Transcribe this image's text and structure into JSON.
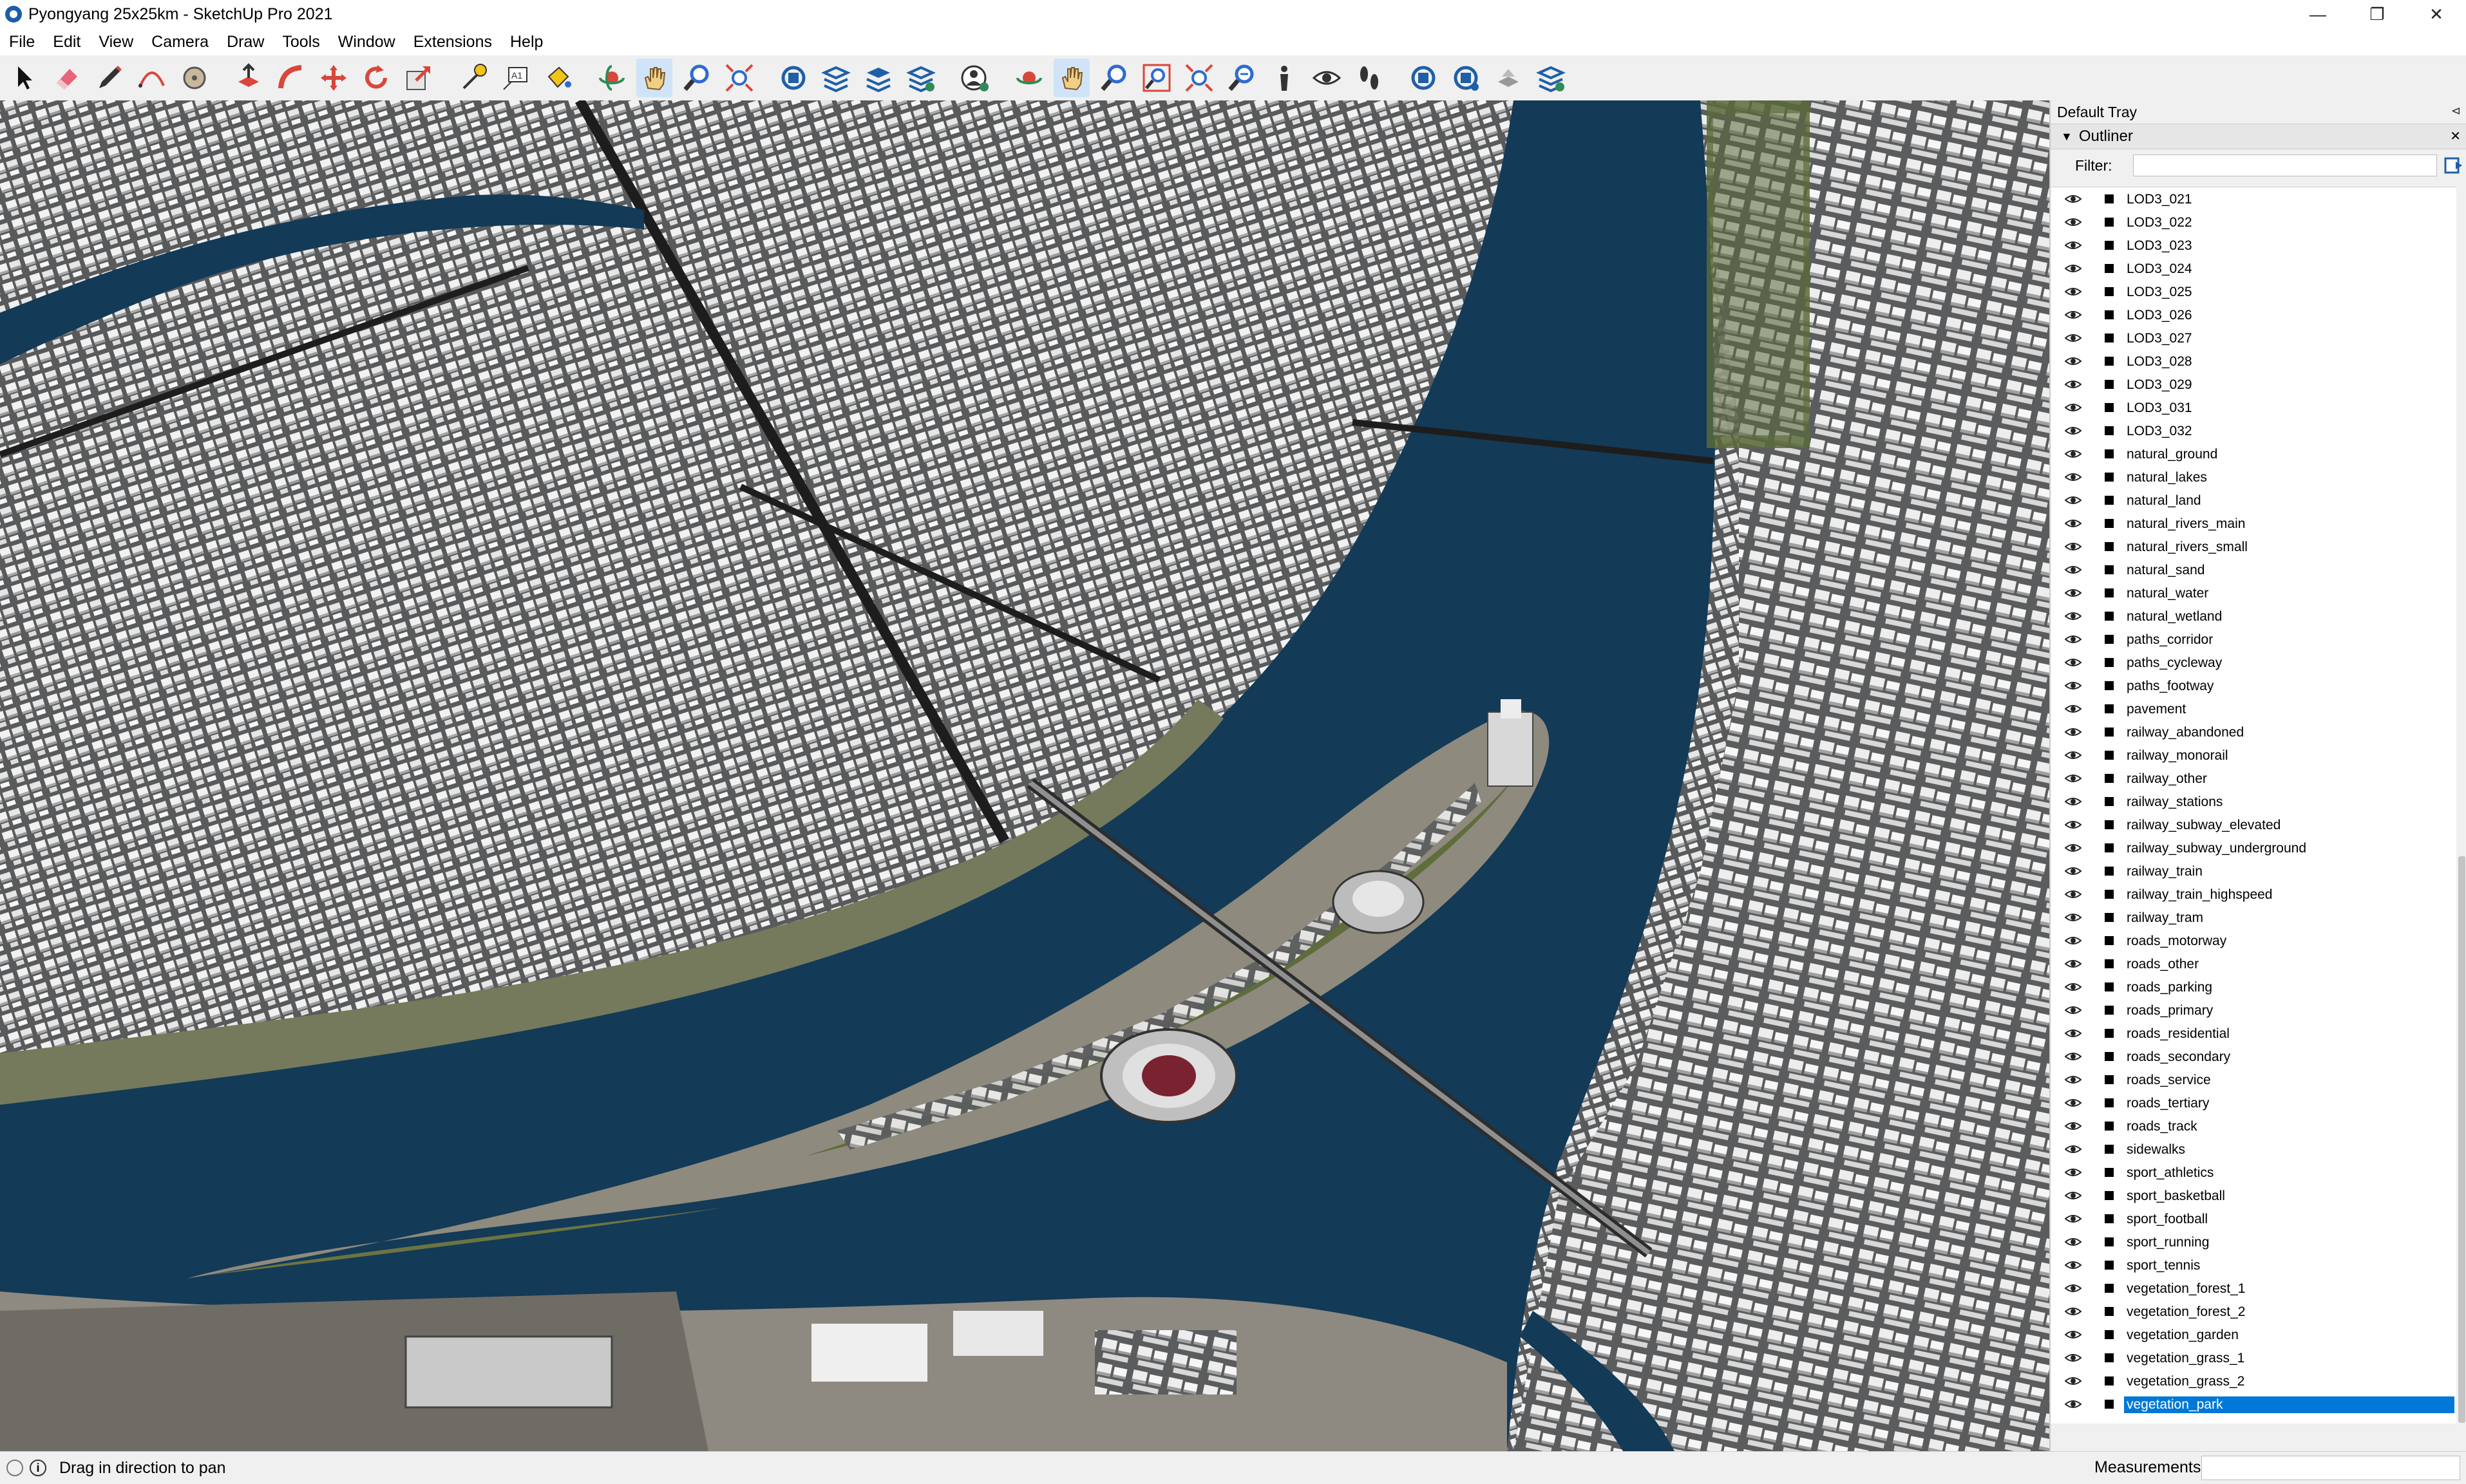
{
  "window": {
    "title": "Pyongyang 25x25km - SketchUp Pro 2021",
    "controls": [
      "—",
      "❐",
      "✕"
    ]
  },
  "menu": [
    "File",
    "Edit",
    "View",
    "Camera",
    "Draw",
    "Tools",
    "Window",
    "Extensions",
    "Help"
  ],
  "toolbar_icons": [
    "select-icon",
    "eraser-icon",
    "pencil-icon",
    "arc-icon",
    "shapes-icon",
    "push-pull-icon",
    "follow-me-icon",
    "move-icon",
    "rotate-icon",
    "scale-icon",
    "tape-measure-icon",
    "text-icon",
    "paint-bucket-icon",
    "orbit-icon",
    "pan-icon",
    "zoom-icon",
    "zoom-extents-icon",
    "warehouse-icon",
    "extension-warehouse-icon",
    "layout-icon",
    "extension-manager-icon",
    "profile-icon",
    "orbit-icon-2",
    "pan-icon-2",
    "zoom-icon-2",
    "zoom-window-icon",
    "zoom-extents-icon-2",
    "previous-icon",
    "position-camera-icon",
    "look-around-icon",
    "walk-icon",
    "sandbox-icon",
    "geolocation-icon",
    "model-info-icon",
    "plugins-icon"
  ],
  "tray": {
    "title": "Default Tray",
    "pin": "⊲",
    "panel_title": "Outliner",
    "panel_close": "✕",
    "filter_label": "Filter:",
    "items": [
      "LOD3_021",
      "LOD3_022",
      "LOD3_023",
      "LOD3_024",
      "LOD3_025",
      "LOD3_026",
      "LOD3_027",
      "LOD3_028",
      "LOD3_029",
      "LOD3_031",
      "LOD3_032",
      "natural_ground",
      "natural_lakes",
      "natural_land",
      "natural_rivers_main",
      "natural_rivers_small",
      "natural_sand",
      "natural_water",
      "natural_wetland",
      "paths_corridor",
      "paths_cycleway",
      "paths_footway",
      "pavement",
      "railway_abandoned",
      "railway_monorail",
      "railway_other",
      "railway_stations",
      "railway_subway_elevated",
      "railway_subway_underground",
      "railway_train",
      "railway_train_highspeed",
      "railway_tram",
      "roads_motorway",
      "roads_other",
      "roads_parking",
      "roads_primary",
      "roads_residential",
      "roads_secondary",
      "roads_service",
      "roads_tertiary",
      "roads_track",
      "sidewalks",
      "sport_athletics",
      "sport_basketball",
      "sport_football",
      "sport_running",
      "sport_tennis",
      "vegetation_forest_1",
      "vegetation_forest_2",
      "vegetation_garden",
      "vegetation_grass_1",
      "vegetation_grass_2",
      "vegetation_park"
    ],
    "selected_item": "vegetation_park"
  },
  "status": {
    "info_icon": "i",
    "text": "Drag in direction to pan",
    "measurements_label": "Measurements"
  },
  "colors": {
    "river": "#133a57",
    "sand": "#8e8a82",
    "vegetation": "#5a6a3a",
    "buildings": "#f2f2f2",
    "ground": "#5a5c5e",
    "selection": "#0078d7"
  }
}
